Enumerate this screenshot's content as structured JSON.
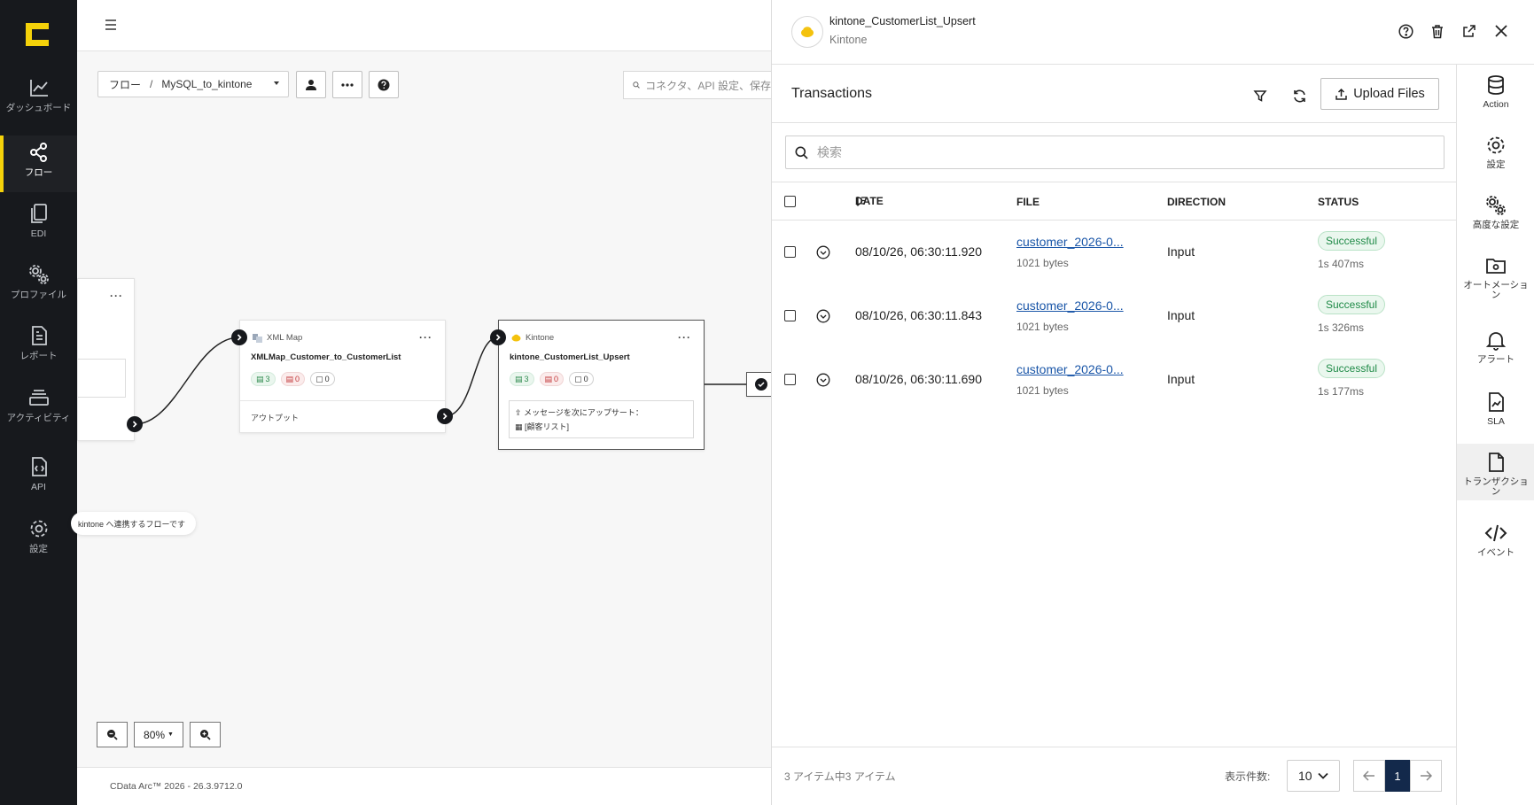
{
  "leftnav": {
    "items": [
      {
        "label": "ダッシュボード",
        "icon": "chart-line-icon"
      },
      {
        "label": "フロー",
        "icon": "share-nodes-icon",
        "active": true
      },
      {
        "label": "EDI",
        "icon": "documents-icon"
      },
      {
        "label": "プロファイル",
        "icon": "gears-icon"
      },
      {
        "label": "レポート",
        "icon": "report-icon"
      },
      {
        "label": "アクティビティ",
        "icon": "stack-icon"
      },
      {
        "label": "API",
        "icon": "api-file-icon"
      },
      {
        "label": "設定",
        "icon": "gear-icon"
      }
    ],
    "accent": "#f5d20a"
  },
  "canvas": {
    "breadcrumb": {
      "root": "フロー",
      "separator": "/",
      "current": "MySQL_to_kintone"
    },
    "search_placeholder": "コネクタ、API 設定、保存",
    "nodes": {
      "left_partial": {
        "more": "···"
      },
      "xmlmap": {
        "type": "XML Map",
        "name": "XMLMap_Customer_to_CustomerList",
        "badges": [
          "3",
          "0",
          "0"
        ],
        "output_label": "アウトプット",
        "more": "···"
      },
      "kintone": {
        "type": "Kintone",
        "name": "kintone_CustomerList_Upsert",
        "badges": [
          "3",
          "0",
          "0"
        ],
        "message_line1": "メッセージを次にアップサート：",
        "message_line2": "[顧客リスト]",
        "more": "···"
      }
    },
    "tooltip": "kintone へ連携するフローです",
    "zoom": "80%",
    "footer": "CData Arc™ 2026 - 26.3.9712.0"
  },
  "panel": {
    "title": "kintone_CustomerList_Upsert",
    "subtitle": "Kintone",
    "transactions": {
      "title": "Transactions",
      "upload_label": "Upload Files",
      "search_placeholder": "検索",
      "columns": {
        "date": "DATE",
        "file": "FILE",
        "direction": "DIRECTION",
        "status": "STATUS"
      },
      "rows": [
        {
          "date": "08/10/26, 06:30:11.920",
          "file": "customer_2026-0...",
          "size": "1021 bytes",
          "direction": "Input",
          "status": "Successful",
          "elapsed": "1s 407ms"
        },
        {
          "date": "08/10/26, 06:30:11.843",
          "file": "customer_2026-0...",
          "size": "1021 bytes",
          "direction": "Input",
          "status": "Successful",
          "elapsed": "1s 326ms"
        },
        {
          "date": "08/10/26, 06:30:11.690",
          "file": "customer_2026-0...",
          "size": "1021 bytes",
          "direction": "Input",
          "status": "Successful",
          "elapsed": "1s 177ms"
        }
      ],
      "footer": {
        "count_text": "3 アイテム中3 アイテム",
        "page_size_label": "表示件数:",
        "page_size": "10",
        "current_page": "1"
      }
    },
    "rail": [
      {
        "label": "Action",
        "icon": "database-icon"
      },
      {
        "label": "設定",
        "icon": "gear-icon"
      },
      {
        "label": "高度な設定",
        "icon": "gears-icon"
      },
      {
        "label": "オートメーション",
        "icon": "automation-folder-icon"
      },
      {
        "label": "アラート",
        "icon": "bell-icon"
      },
      {
        "label": "SLA",
        "icon": "sla-file-icon"
      },
      {
        "label": "トランザクション",
        "icon": "transaction-file-icon",
        "active": true
      },
      {
        "label": "イベント",
        "icon": "code-icon"
      }
    ]
  },
  "colors": {
    "status_success": "#1f8a47",
    "link": "#1a56a8",
    "pager_active": "#13294b"
  }
}
